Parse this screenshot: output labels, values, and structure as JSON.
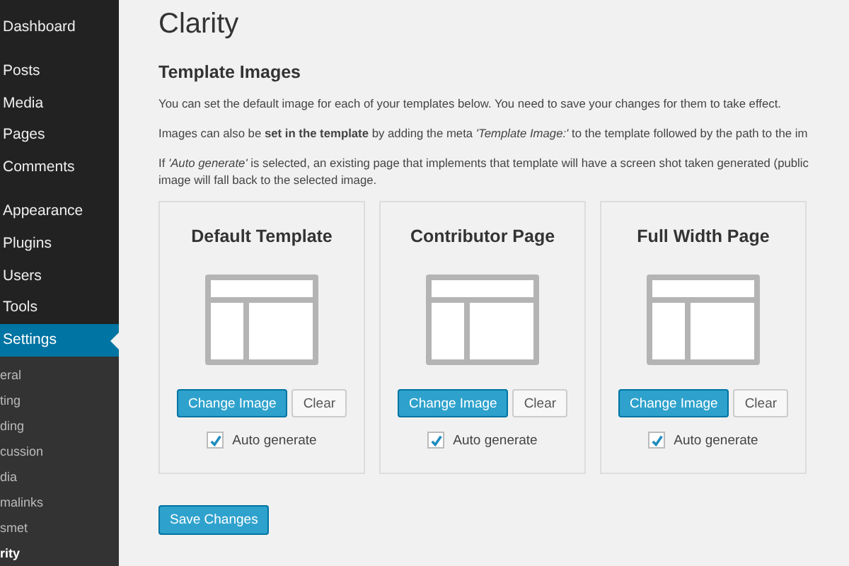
{
  "sidebar": {
    "groups": [
      {
        "items": [
          {
            "label": "Dashboard",
            "selected": false
          }
        ]
      },
      {
        "items": [
          {
            "label": "Posts",
            "selected": false
          },
          {
            "label": "Media",
            "selected": false
          },
          {
            "label": "Pages",
            "selected": false
          },
          {
            "label": "Comments",
            "selected": false
          }
        ]
      },
      {
        "items": [
          {
            "label": "Appearance",
            "selected": false
          },
          {
            "label": "Plugins",
            "selected": false
          },
          {
            "label": "Users",
            "selected": false
          },
          {
            "label": "Tools",
            "selected": false
          },
          {
            "label": "Settings",
            "selected": true
          }
        ]
      }
    ],
    "submenu": [
      {
        "label": "eral",
        "selected": false
      },
      {
        "label": "ting",
        "selected": false
      },
      {
        "label": "ding",
        "selected": false
      },
      {
        "label": "cussion",
        "selected": false
      },
      {
        "label": "dia",
        "selected": false
      },
      {
        "label": "malinks",
        "selected": false
      },
      {
        "label": "smet",
        "selected": false
      },
      {
        "label": "rity",
        "selected": true
      }
    ]
  },
  "page_title": "Clarity",
  "section_title": "Template Images",
  "paragraphs": [
    "You can set the default image for each of your templates below. You need to save your changes for them to take effect.",
    "Images can also be **set in the template** by adding the meta *'Template Image:'* to the template followed by the path to the im",
    "If *'Auto generate'* is selected, an existing page that implements that template will have a screen shot taken generated (public\nimage will fall back to the selected image."
  ],
  "templates": [
    {
      "title": "Default Template",
      "change_button": "Change Image",
      "clear_button": "Clear",
      "auto_generate": {
        "label": "Auto generate",
        "checked": true
      }
    },
    {
      "title": "Contributor Page",
      "change_button": "Change Image",
      "clear_button": "Clear",
      "auto_generate": {
        "label": "Auto generate",
        "checked": true
      }
    },
    {
      "title": "Full Width Page",
      "change_button": "Change Image",
      "clear_button": "Clear",
      "auto_generate": {
        "label": "Auto generate",
        "checked": true
      }
    }
  ],
  "save_button": "Save Changes"
}
